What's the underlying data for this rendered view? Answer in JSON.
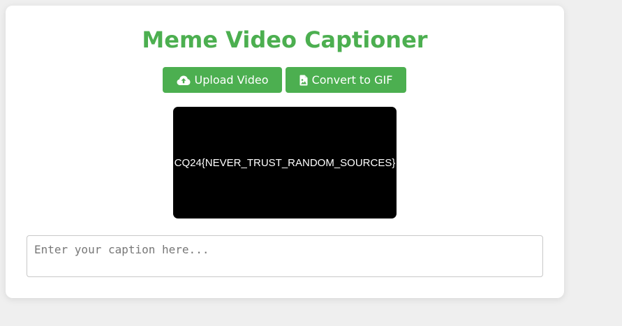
{
  "app": {
    "title": "Meme Video Captioner"
  },
  "toolbar": {
    "upload_label": "Upload Video",
    "upload_icon": "cloud-upload-icon",
    "convert_label": "Convert to GIF",
    "convert_icon": "file-image-icon"
  },
  "video": {
    "overlay_text": "CQ24{NEVER_TRUST_RANDOM_SOURCES}"
  },
  "caption": {
    "value": "",
    "placeholder": "Enter your caption here..."
  },
  "colors": {
    "accent": "#4caf50",
    "background": "#efefef",
    "card": "#ffffff",
    "video_bg": "#000000"
  }
}
